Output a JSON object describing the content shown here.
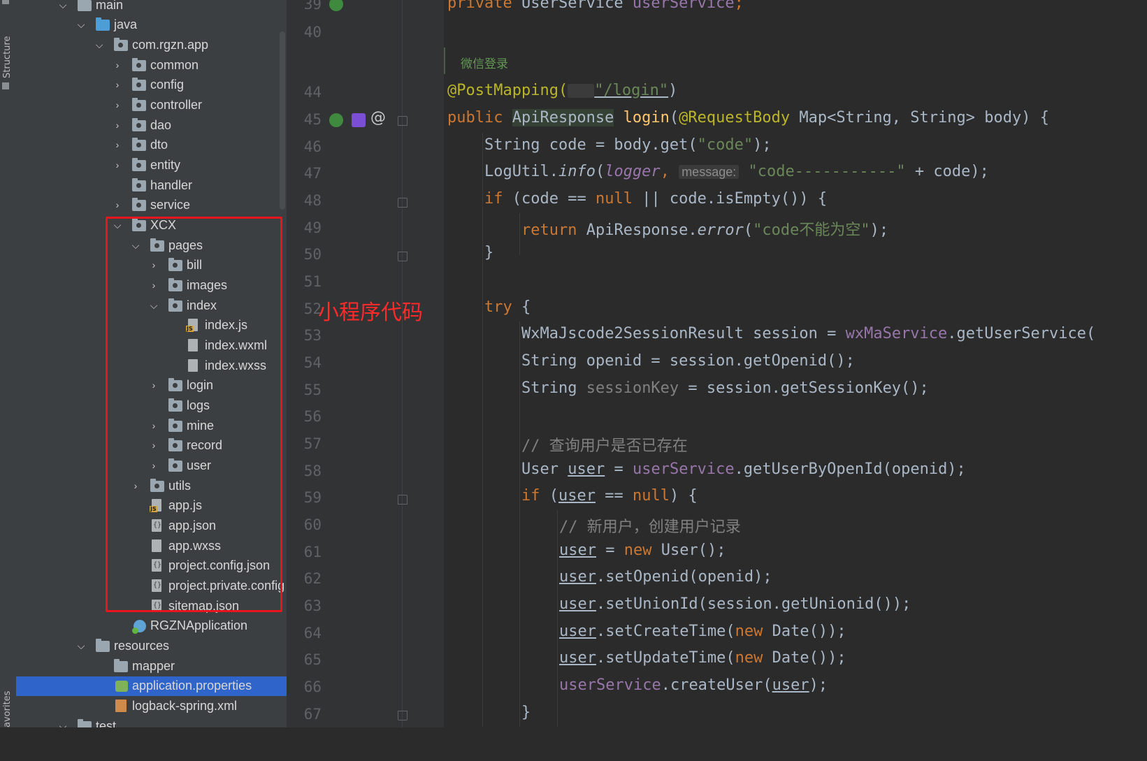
{
  "side_strip": {
    "structure_label": "Structure",
    "favorites_label": "avorites"
  },
  "tree": {
    "items": [
      {
        "label": "main"
      },
      {
        "label": "java"
      },
      {
        "label": "com.rgzn.app"
      },
      {
        "label": "common"
      },
      {
        "label": "config"
      },
      {
        "label": "controller"
      },
      {
        "label": "dao"
      },
      {
        "label": "dto"
      },
      {
        "label": "entity"
      },
      {
        "label": "handler"
      },
      {
        "label": "service"
      },
      {
        "label": "XCX"
      },
      {
        "label": "pages"
      },
      {
        "label": "bill"
      },
      {
        "label": "images"
      },
      {
        "label": "index"
      },
      {
        "label": "index.js"
      },
      {
        "label": "index.wxml"
      },
      {
        "label": "index.wxss"
      },
      {
        "label": "login"
      },
      {
        "label": "logs"
      },
      {
        "label": "mine"
      },
      {
        "label": "record"
      },
      {
        "label": "user"
      },
      {
        "label": "utils"
      },
      {
        "label": "app.js"
      },
      {
        "label": "app.json"
      },
      {
        "label": "app.wxss"
      },
      {
        "label": "project.config.json"
      },
      {
        "label": "project.private.config"
      },
      {
        "label": "sitemap.json"
      },
      {
        "label": "RGZNApplication"
      },
      {
        "label": "resources"
      },
      {
        "label": "mapper"
      },
      {
        "label": "application.properties"
      },
      {
        "label": "logback-spring.xml"
      },
      {
        "label": "test"
      }
    ],
    "selected": "application.properties"
  },
  "annotation": {
    "text": "小程序代码",
    "color": "#ff2a2a"
  },
  "editor": {
    "line_numbers": [
      "39",
      "40",
      "44",
      "45",
      "46",
      "47",
      "48",
      "49",
      "50",
      "51",
      "52",
      "53",
      "54",
      "55",
      "56",
      "57",
      "58",
      "59",
      "60",
      "61",
      "62",
      "63",
      "64",
      "65",
      "66",
      "67"
    ],
    "doc_comment": "微信登录",
    "code": {
      "l39": {
        "kw": "private ",
        "type": "UserService ",
        "field": "userService",
        "semi": ";"
      },
      "l44": {
        "ann": "@PostMapping(",
        "str": "\"/login\"",
        "close": ")"
      },
      "l45": {
        "kw": "public ",
        "type": "ApiResponse",
        "fn": " login",
        "rest1": "(",
        "ann": "@RequestBody",
        "rest2": " Map<String, String> body) {"
      },
      "l46": {
        "a": "String code = body.get(",
        "s": "\"code\"",
        "b": ");"
      },
      "l47": {
        "a": "LogUtil.",
        "it": "info",
        "p": "(",
        "fld": "logger",
        "c": ", ",
        "hint": "message:",
        "s": " \"code-----------\"",
        "b": " + code);"
      },
      "l48": {
        "kw": "if ",
        "a": "(code == ",
        "kw2": "null",
        "b": " || code.isEmpty()) {"
      },
      "l49": {
        "kw": "return ",
        "a": "ApiResponse.",
        "it": "error",
        "p": "(",
        "s": "\"code不能为空\"",
        "b": ");"
      },
      "l50": {
        "a": "}"
      },
      "l52": {
        "kw": "try ",
        "a": "{"
      },
      "l53": {
        "a": "WxMaJscode2SessionResult session = ",
        "fld": "wxMaService",
        "b": ".getUserService("
      },
      "l54": {
        "a": "String openid = session.getOpenid();"
      },
      "l55": {
        "a": "String ",
        "cm": "sessionKey",
        "b": " = session.getSessionKey();"
      },
      "l57": {
        "cm": "// 查询用户是否已存在"
      },
      "l58": {
        "a": "User ",
        "ul": "user",
        "b": " = ",
        "fld": "userService",
        "c": ".getUserByOpenId(openid);"
      },
      "l59": {
        "kw": "if ",
        "a": "(",
        "ul": "user",
        "b": " == ",
        "kw2": "null",
        "c": ") {"
      },
      "l60": {
        "cm": "// 新用户，创建用户记录"
      },
      "l61": {
        "ul": "user",
        "a": " = ",
        "kw": "new ",
        "b": "User();"
      },
      "l62": {
        "ul": "user",
        "a": ".setOpenid(openid);"
      },
      "l63": {
        "ul": "user",
        "a": ".setUnionId(session.getUnionid());"
      },
      "l64": {
        "ul": "user",
        "a": ".setCreateTime(",
        "kw": "new ",
        "b": "Date());"
      },
      "l65": {
        "ul": "user",
        "a": ".setUpdateTime(",
        "kw": "new ",
        "b": "Date());"
      },
      "l66": {
        "fld": "userService",
        "a": ".createUser(",
        "ul": "user",
        "b": ");"
      },
      "l67": {
        "a": "}"
      }
    }
  }
}
